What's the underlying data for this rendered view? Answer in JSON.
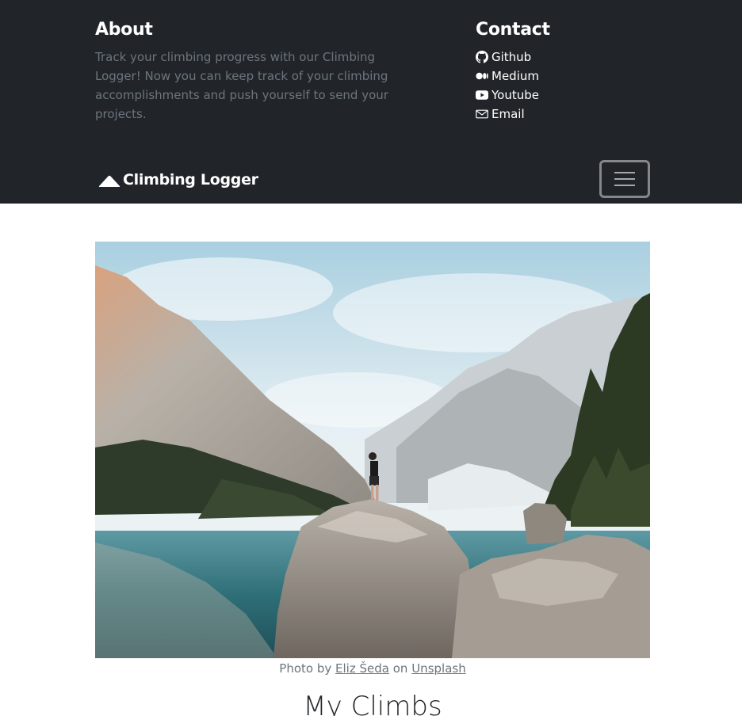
{
  "about": {
    "heading": "About",
    "text": "Track your climbing progress with our Climbing Logger! Now you can keep track of your climbing accomplishments and push yourself to send your projects."
  },
  "contact": {
    "heading": "Contact",
    "links": [
      {
        "label": "Github",
        "icon": "github-icon"
      },
      {
        "label": "Medium",
        "icon": "medium-icon"
      },
      {
        "label": "Youtube",
        "icon": "youtube-icon"
      },
      {
        "label": "Email",
        "icon": "email-icon"
      }
    ]
  },
  "navbar": {
    "brand": "Climbing Logger",
    "brand_icon": "mountain-icon",
    "toggler_icon": "hamburger-icon"
  },
  "hero": {
    "caption_prefix": "Photo by",
    "author": "Eliz Šeda",
    "caption_mid": "on",
    "source": "Unsplash"
  },
  "main": {
    "title": "My Climbs"
  },
  "colors": {
    "dark_bg": "#212529",
    "muted": "#6c757d",
    "white": "#ffffff"
  }
}
